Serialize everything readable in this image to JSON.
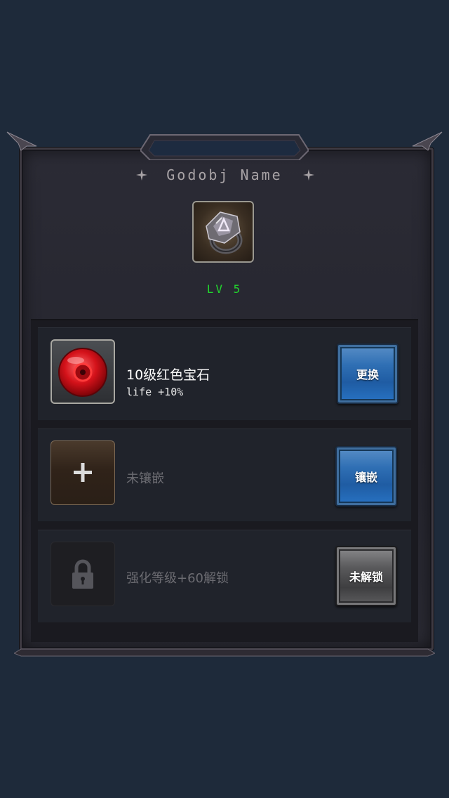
{
  "item": {
    "name": "Godobj Name",
    "level": "LV 5",
    "icon": "ring-icon"
  },
  "slots": [
    {
      "state": "filled",
      "icon": "red-gem-icon",
      "title": "10级红色宝石",
      "subtitle": "life +10%",
      "button": "更换"
    },
    {
      "state": "empty",
      "icon": "plus-icon",
      "title": "未镶嵌",
      "button": "镶嵌"
    },
    {
      "state": "locked",
      "icon": "lock-icon",
      "title": "强化等级+60解锁",
      "button": "未解锁"
    }
  ],
  "colors": {
    "background": "#1e2a3a",
    "level": "#22d52e",
    "button_blue": "#2873c4",
    "button_gray": "#5a5a5c"
  }
}
